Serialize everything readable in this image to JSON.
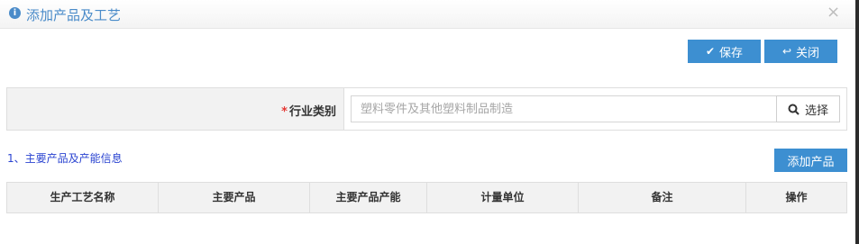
{
  "dialog": {
    "title": "添加产品及工艺",
    "close_symbol": "×"
  },
  "toolbar": {
    "save_label": "保存",
    "close_label": "关闭"
  },
  "form": {
    "required_mark": "*",
    "industry_label": "行业类别",
    "industry_placeholder": "塑料零件及其他塑料制品制造",
    "select_label": "选择"
  },
  "section": {
    "title": "1、主要产品及产能信息",
    "add_button_label": "添加产品"
  },
  "table": {
    "columns": [
      "生产工艺名称",
      "主要产品",
      "主要产品产能",
      "计量单位",
      "备注",
      "操作"
    ]
  },
  "icons": {
    "title": "info-icon",
    "save": "check-icon",
    "close": "return-icon",
    "select": "search-icon"
  },
  "colors": {
    "accent": "#3d8fd1",
    "title": "#4a8bc9",
    "required": "#e53935",
    "section_title": "#2b44d1"
  }
}
